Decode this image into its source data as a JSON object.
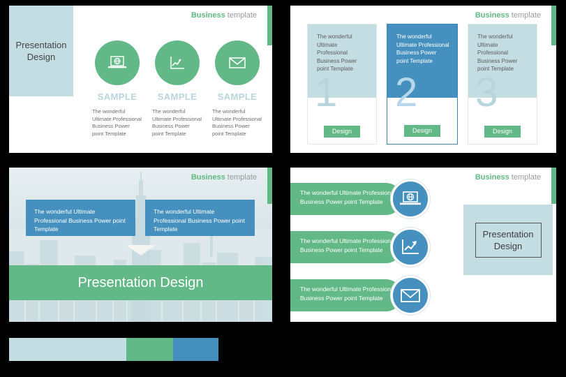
{
  "palette": {
    "swatches": [
      {
        "name": "pale-blue",
        "hex": "#C3DDE2"
      },
      {
        "name": "green",
        "hex": "#62B886"
      },
      {
        "name": "blue",
        "hex": "#4590BE"
      }
    ]
  },
  "header": {
    "brand": "Business",
    "suffix": "template"
  },
  "slide1": {
    "title": "Presentation\nDesign",
    "title_line1": "Presentation",
    "title_line2": "Design",
    "columns": [
      {
        "icon": "laptop-globe-icon",
        "label": "SAMPLE",
        "desc": "The wonderful Ultimate Professional Business Power point Template"
      },
      {
        "icon": "line-chart-icon",
        "label": "SAMPLE",
        "desc": "The wonderful Ultimate Professional Business Power point Template"
      },
      {
        "icon": "envelope-icon",
        "label": "SAMPLE",
        "desc": "The wonderful Ultimate Professional Business Power point Template"
      }
    ]
  },
  "slide2": {
    "cards": [
      {
        "text": "The wonderful Ultimate Professional Business Power point Template",
        "number": "1",
        "button": "Design",
        "variant": "light"
      },
      {
        "text": "The wonderful Ultimate Professional Business Power point Template",
        "number": "2",
        "button": "Design",
        "variant": "blue"
      },
      {
        "text": "The wonderful Ultimate Professional Business Power point Template",
        "number": "3",
        "button": "Design",
        "variant": "light"
      }
    ]
  },
  "slide3": {
    "boxes": [
      {
        "text": "The wonderful Ultimate Professional Business Power point Template"
      },
      {
        "text": "The wonderful Ultimate Professional Business Power point Template"
      }
    ],
    "banner": "Presentation Design"
  },
  "slide4": {
    "rows": [
      {
        "text": "The wonderful Ultimate Professional Business Power point Template",
        "icon": "laptop-globe-icon"
      },
      {
        "text": "The wonderful Ultimate Professional Business Power point Template",
        "icon": "line-chart-icon"
      },
      {
        "text": "The wonderful Ultimate Professional Business Power point Template",
        "icon": "envelope-icon"
      }
    ],
    "panel_line1": "Presentation",
    "panel_line2": "Design"
  }
}
